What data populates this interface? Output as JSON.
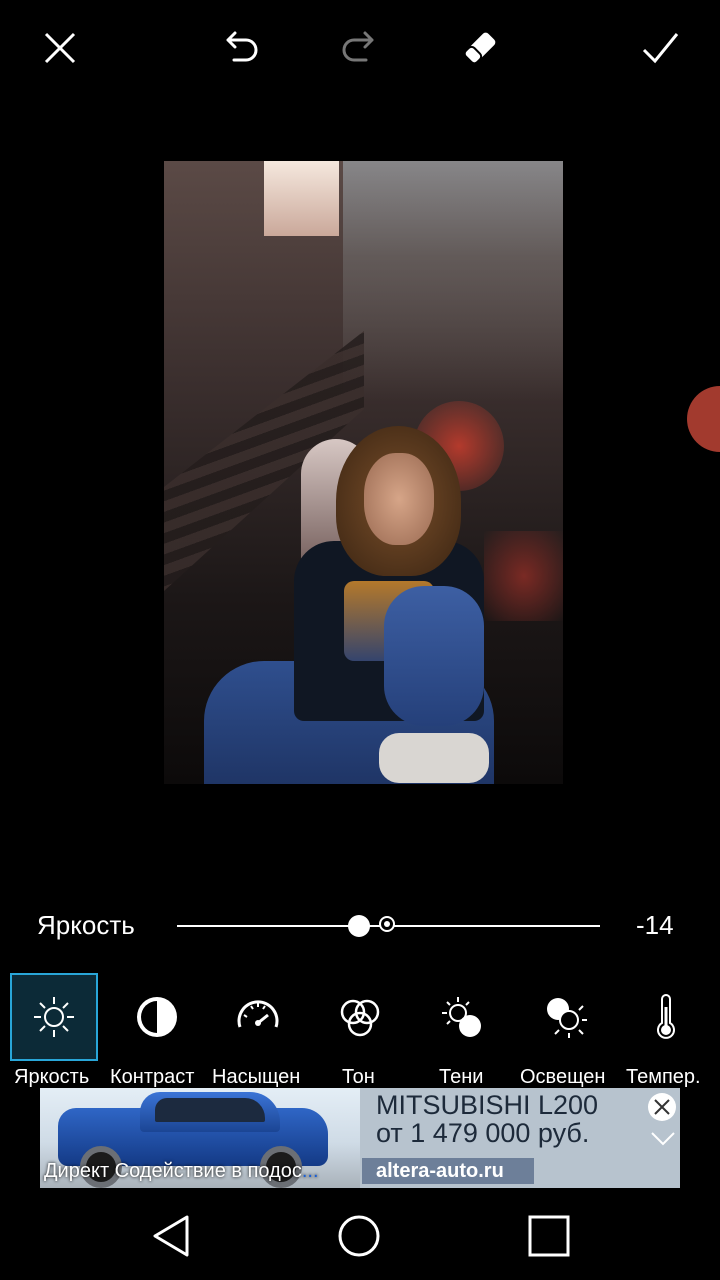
{
  "toolbar": {
    "close_icon": "close-icon",
    "undo_icon": "undo-icon",
    "redo_icon": "redo-icon",
    "eraser_icon": "eraser-icon",
    "apply_icon": "checkmark-icon"
  },
  "adjustment": {
    "label": "Яркость",
    "value": "-14",
    "slider_level": -14,
    "slider_range": [
      -100,
      100
    ]
  },
  "tools": [
    {
      "label": "Яркость",
      "icon": "sun-icon",
      "selected": true
    },
    {
      "label": "Контраст",
      "icon": "contrast-icon",
      "selected": false
    },
    {
      "label": "Насыщен",
      "icon": "gauge-icon",
      "selected": false
    },
    {
      "label": "Тон",
      "icon": "color-circles-icon",
      "selected": false
    },
    {
      "label": "Тени",
      "icon": "shadows-icon",
      "selected": false
    },
    {
      "label": "Освещен",
      "icon": "highlights-icon",
      "selected": false
    },
    {
      "label": "Темпер.",
      "icon": "thermometer-icon",
      "selected": false
    }
  ],
  "ad": {
    "title": "MITSUBISHI L200",
    "price": "от 1 479 000 руб.",
    "domain": "altera-auto.ru",
    "direct_text": "Директ  Содействие в подос",
    "ellipsis": "...",
    "colors": {
      "background": "#b7c3ce",
      "domain_bg": "#6d7f99",
      "ellipsis": "#1a5fd6"
    }
  },
  "colors": {
    "accent": "#29a6d8",
    "selected_tool_bg": "#0c2a37"
  },
  "navbar": [
    "back-icon",
    "home-icon",
    "recents-icon"
  ]
}
